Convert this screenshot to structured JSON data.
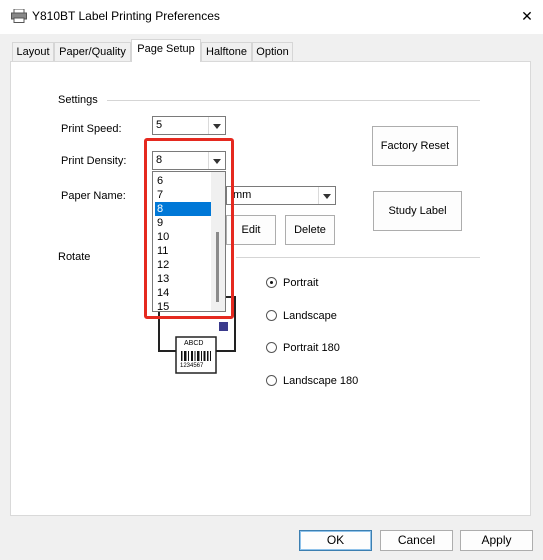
{
  "window": {
    "title": "Y810BT Label Printing Preferences",
    "close_icon": "close-icon"
  },
  "tabs": [
    {
      "label": "Layout",
      "active": false
    },
    {
      "label": "Paper/Quality",
      "active": false
    },
    {
      "label": "Page Setup",
      "active": true
    },
    {
      "label": "Halftone",
      "active": false
    },
    {
      "label": "Option",
      "active": false
    }
  ],
  "settings": {
    "group_title": "Settings",
    "print_speed_label": "Print Speed:",
    "print_speed_value": "5",
    "print_density_label": "Print Density:",
    "print_density_value": "8",
    "paper_name_label": "Paper Name:",
    "paper_name_value_visible": "mm",
    "edit_button": "Edit",
    "delete_button": "Delete",
    "factory_reset_button": "Factory Reset",
    "study_label_button": "Study Label"
  },
  "density_dropdown": {
    "options": [
      "6",
      "7",
      "8",
      "9",
      "10",
      "11",
      "12",
      "13",
      "14",
      "15"
    ],
    "selected": "8"
  },
  "rotate": {
    "group_title": "Rotate",
    "options": [
      {
        "label": "Portrait",
        "checked": true
      },
      {
        "label": "Landscape",
        "checked": false
      },
      {
        "label": "Portrait 180",
        "checked": false
      },
      {
        "label": "Landscape 180",
        "checked": false
      }
    ],
    "preview_label_top": "ABCD",
    "preview_label_bottom": "1234567"
  },
  "footer": {
    "ok": "OK",
    "cancel": "Cancel",
    "apply": "Apply"
  },
  "colors": {
    "selection": "#0078d7",
    "highlight_box": "#e5291f",
    "primary_button_border": "#3c7fb1"
  }
}
